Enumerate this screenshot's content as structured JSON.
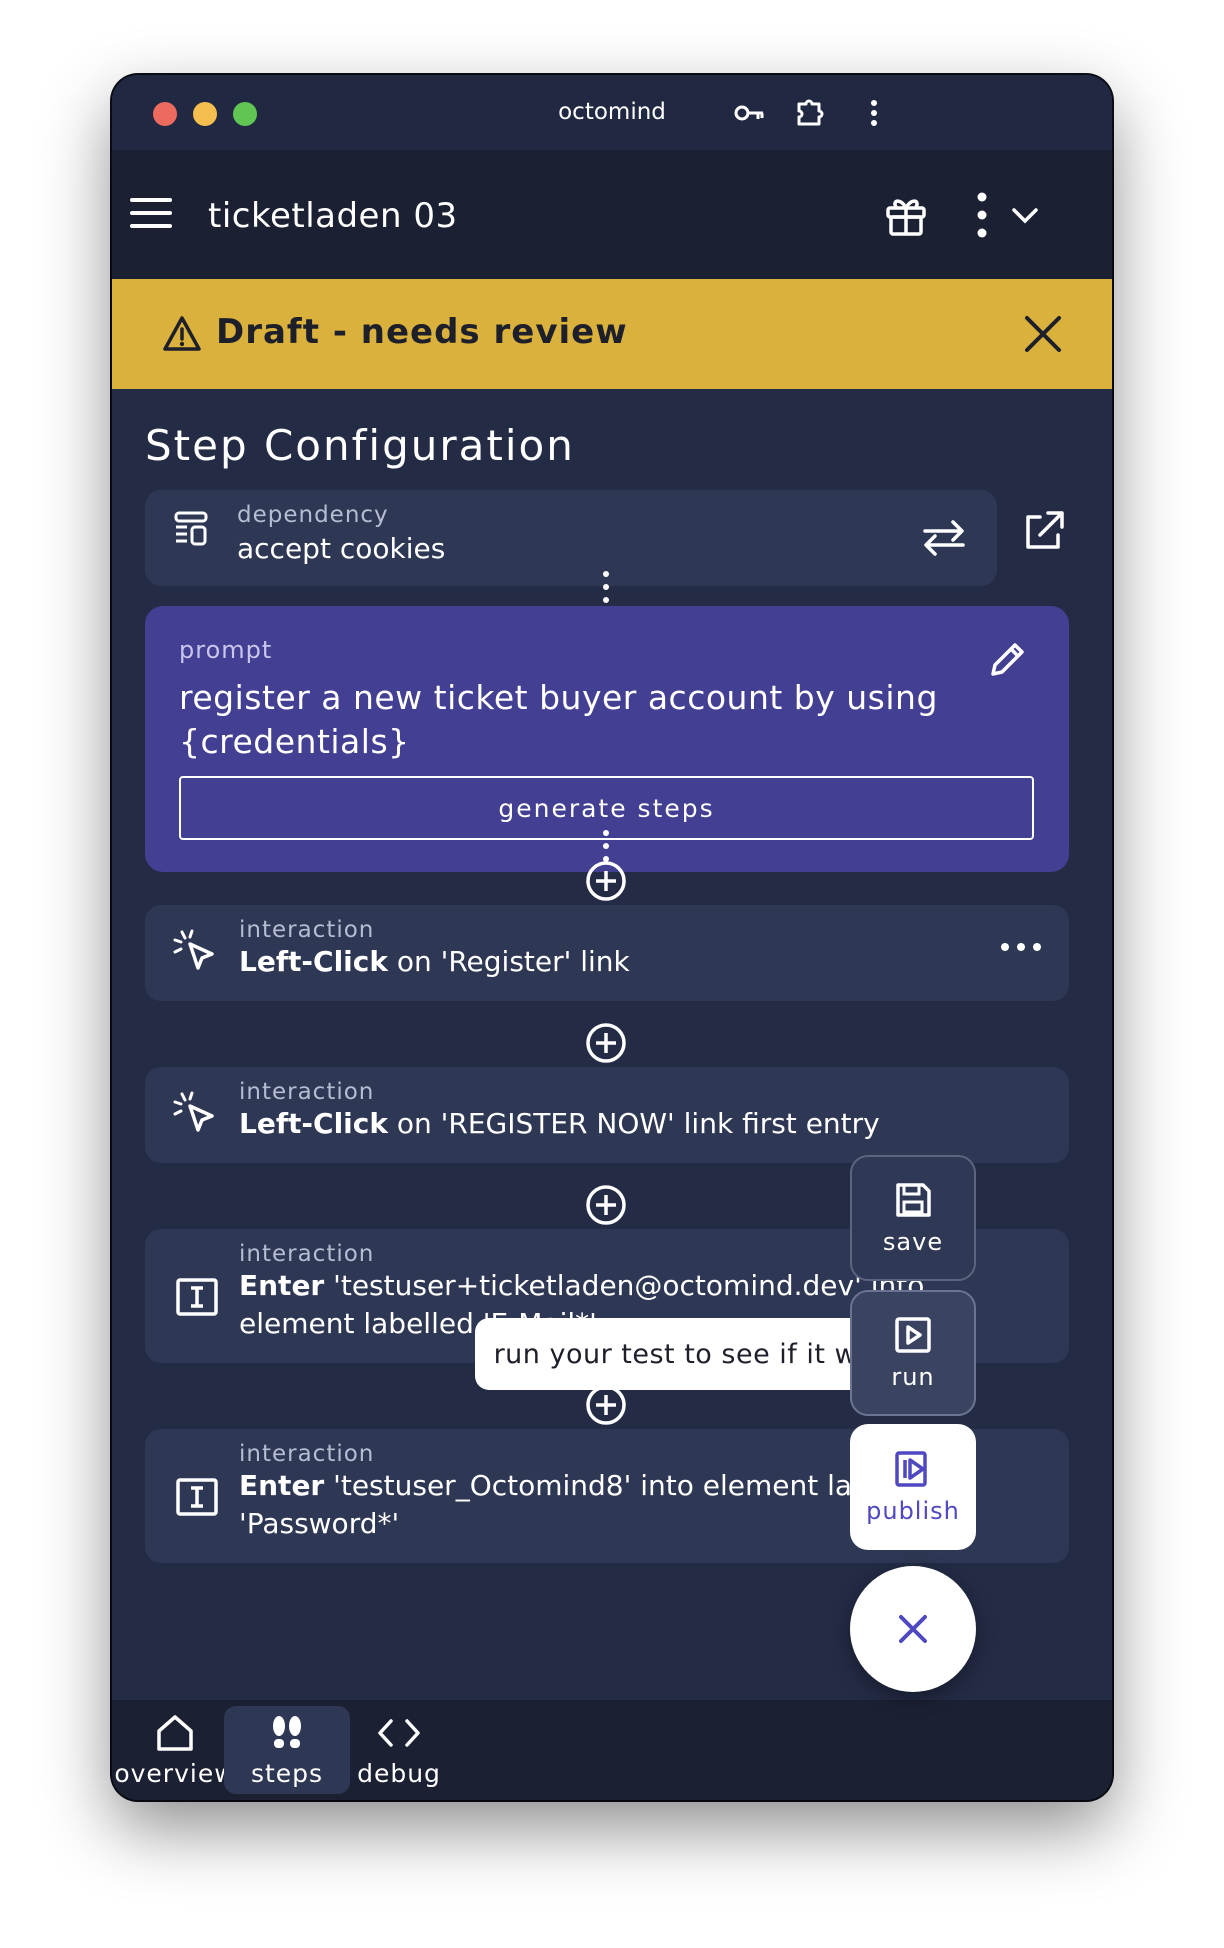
{
  "window": {
    "title": "octomind",
    "titlebar_icons": [
      "key-icon",
      "puzzle-extension-icon",
      "kebab-menu-icon"
    ]
  },
  "appbar": {
    "title": "ticketladen 03",
    "icons": [
      "menu-icon",
      "gift-icon",
      "more-vertical-icon",
      "chevron-down-icon"
    ]
  },
  "banner": {
    "text": "Draft - needs review",
    "color": "#dab13c"
  },
  "section": {
    "title": "Step Configuration"
  },
  "dependency": {
    "label": "dependency",
    "value": "accept cookies"
  },
  "prompt": {
    "label": "prompt",
    "text": "register a new ticket buyer account by using {credentials}",
    "button": "generate steps",
    "color": "#433f92"
  },
  "steps": [
    {
      "label": "interaction",
      "action": "Left-Click",
      "rest": " on 'Register' link"
    },
    {
      "label": "interaction",
      "action": "Left-Click",
      "rest": " on 'REGISTER NOW' link first entry"
    },
    {
      "label": "interaction",
      "action": "Enter",
      "rest": " 'testuser+ticketladen@octomind.dev' into element labelled 'E-Mail*'"
    },
    {
      "label": "interaction",
      "action": "Enter",
      "rest": " 'testuser_Octomind8' into element labelled 'Password*'"
    }
  ],
  "actions": {
    "save": "save",
    "run": "run",
    "publish": "publish",
    "tooltip": "run your test to see if it works"
  },
  "bottomnav": {
    "items": [
      {
        "label": "overview",
        "icon": "home-icon"
      },
      {
        "label": "steps",
        "icon": "footsteps-icon"
      },
      {
        "label": "debug",
        "icon": "code-icon"
      }
    ],
    "active": "steps"
  }
}
